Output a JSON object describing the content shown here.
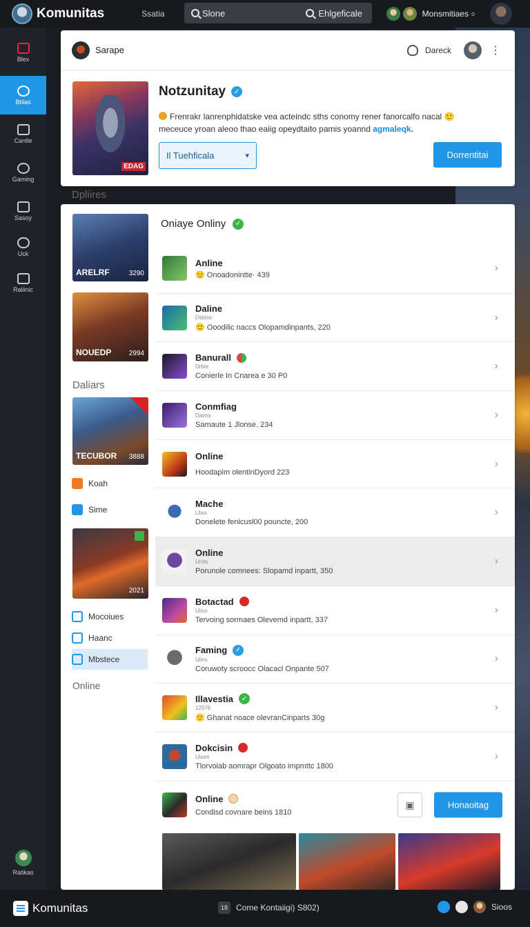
{
  "topbar": {
    "brand": "Komunitas",
    "link": "Ssatia",
    "search_left": "Slone",
    "search_right": "Ehlgeficale",
    "user_label": "Monsmitiaes"
  },
  "sidebar": {
    "items": [
      {
        "label": "Blex",
        "icon": "feed-icon"
      },
      {
        "label": "Btilas",
        "icon": "people-icon"
      },
      {
        "label": "Cantle",
        "icon": "monitor-icon"
      },
      {
        "label": "Gaming",
        "icon": "gear-icon"
      },
      {
        "label": "Sasoy",
        "icon": "stack-icon"
      },
      {
        "label": "Uck",
        "icon": "toggle-icon"
      },
      {
        "label": "Raliinic",
        "icon": "image-icon"
      }
    ],
    "bottom_label": "Ratikas"
  },
  "header": {
    "profile_name": "Sarape",
    "user_label": "Dareck",
    "title": "Notzunitay",
    "description": "Frenrakr lanrenphidatske vea acteindc sths conomy rener fanorcalfo nacal",
    "description2": "meceuce yroan aleoo thao eaiig opeydtaito pamis yoannd",
    "description_link": "agmaleqk.",
    "hero_tag": "EDAG",
    "select_value": "Il Tuehficala",
    "button": "Dorrentitai"
  },
  "sections": {
    "dpliires": "Dpliires",
    "daliars": "Daliars",
    "online": "Online"
  },
  "thumbs": [
    {
      "caption": "ARELRF",
      "num": "3290"
    },
    {
      "caption": "NOUEDP",
      "num": "2994"
    },
    {
      "caption": "TECUBOR",
      "num": "3888"
    },
    {
      "caption": "",
      "num": "2021"
    }
  ],
  "side_links": [
    {
      "label": "Koah",
      "color": "#f07a24"
    },
    {
      "label": "Sime",
      "color": "#2196e6"
    },
    {
      "label": "Mocoiues",
      "color": "#2196e6"
    },
    {
      "label": "Haanc",
      "color": "#2196e6"
    },
    {
      "label": "Mbstece",
      "color": "#2196e6"
    }
  ],
  "list": {
    "header": "Oniaye Onliny",
    "rows": [
      {
        "title": "Anline",
        "sub": "",
        "desc": "Onoadonintte· 439"
      },
      {
        "title": "Daline",
        "sub": "Dsbiss",
        "desc": "Ooodilic naccs Olopamdinpants, 220"
      },
      {
        "title": "Banurall",
        "sub": "Drbie",
        "desc": "Conierle In Cnarea e 30 P0"
      },
      {
        "title": "Conmfiag",
        "sub": "Daims",
        "desc": "Samaute 1 Jlonse. 234"
      },
      {
        "title": "Online",
        "sub": "",
        "desc": "Hoodapim olentinDyord 223"
      },
      {
        "title": "Mache",
        "sub": "Lbss",
        "desc": "Donelete fenicusl00 pouncte, 200"
      },
      {
        "title": "Online",
        "sub": "Units",
        "desc": "Porunole comnees: Slopamd inpartt, 350"
      },
      {
        "title": "Botactad",
        "sub": "Uiius",
        "desc": "Tervoing sormaes Olevemd inpartt, 337"
      },
      {
        "title": "Faming",
        "sub": "Uiins",
        "desc": "Coruwoty scroocc Olacacl Onpante 507"
      },
      {
        "title": "Illavestia",
        "sub": "12076",
        "desc": "Ghanat noace olevranCinparts 30g"
      },
      {
        "title": "Dokcisin",
        "sub": "Uiues",
        "desc": "Tlorvoiab aomrapr Olgoato impmttc 1800"
      },
      {
        "title": "Online",
        "sub": "",
        "desc": "Condisd covnare beins 1810"
      }
    ],
    "last_button": "Honaoitag"
  },
  "bottombar": {
    "brand": "Komunitas",
    "key": "18",
    "center": "Come Kontaiigi) S802)",
    "right": "Sioos"
  }
}
